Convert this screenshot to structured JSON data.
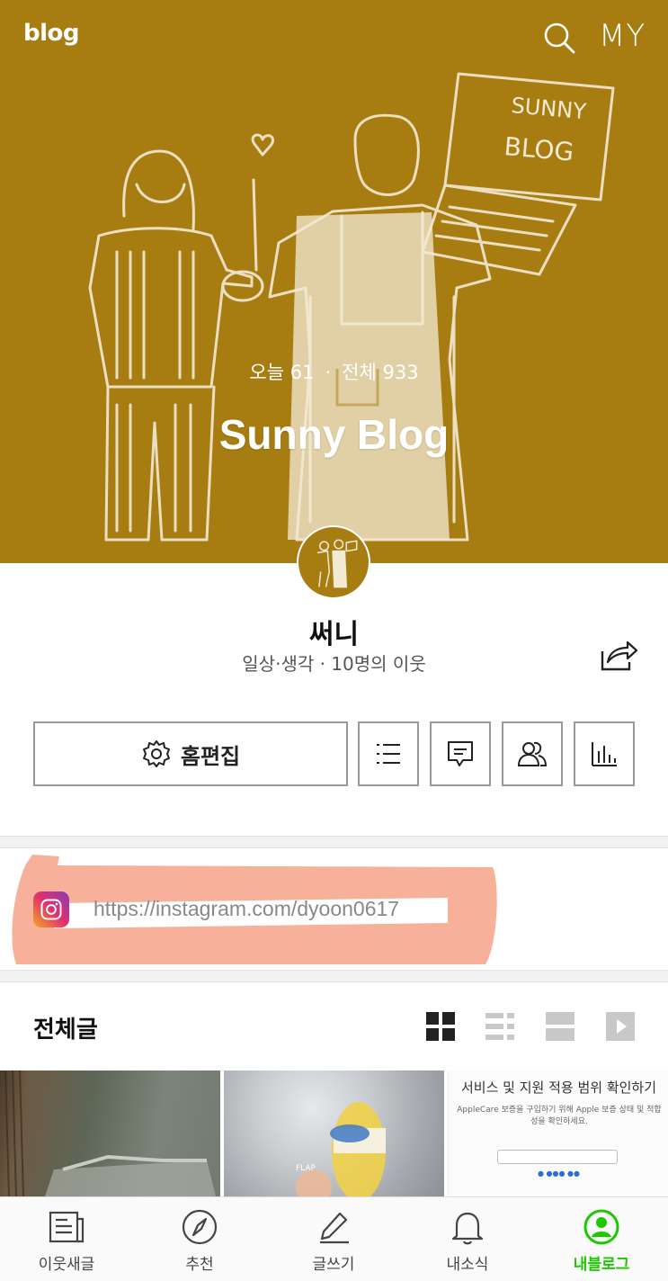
{
  "header": {
    "logo": "blog",
    "my_label": "MY",
    "visits": {
      "today_label": "오늘 61",
      "total_label": "전체 933",
      "separator": "·"
    },
    "blog_title": "Sunny Blog",
    "cover_art_text": [
      "SUNNY",
      "BLOG"
    ]
  },
  "profile": {
    "nickname": "써니",
    "meta": "일상·생각 · 10명의 이웃"
  },
  "actions": {
    "edit_home_label": "홈편집",
    "icons": [
      "list-icon",
      "comment-icon",
      "neighbors-icon",
      "stats-icon"
    ]
  },
  "link": {
    "url": "https://instagram.com/dyoon0617",
    "icon": "instagram-icon",
    "highlight_color": "#f6a990"
  },
  "posts": {
    "section_title": "전체글",
    "view_options": [
      "grid-view-icon",
      "list-view-icon",
      "card-view-icon",
      "video-view-icon"
    ],
    "thumb3": {
      "title": "서비스 및 지원 적용 범위 확인하기",
      "body": "AppleCare 보증을 구입하기 위해 Apple 보증 상태 및 적합성을 확인하세요."
    },
    "thumb2": {
      "caption": "FLAP"
    }
  },
  "bottom_nav": {
    "items": [
      {
        "label": "이웃새글",
        "icon": "neighbor-news-icon"
      },
      {
        "label": "추천",
        "icon": "compass-icon"
      },
      {
        "label": "글쓰기",
        "icon": "pencil-icon"
      },
      {
        "label": "내소식",
        "icon": "bell-icon"
      },
      {
        "label": "내블로그",
        "icon": "my-blog-icon"
      }
    ],
    "active_color": "#1ec800"
  },
  "colors": {
    "cover_bg": "#a77d12",
    "accent": "#1ec800"
  }
}
